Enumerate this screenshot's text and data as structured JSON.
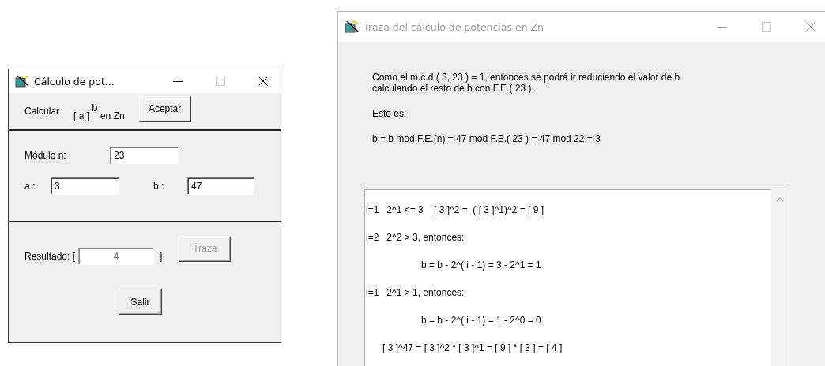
{
  "calc_window": {
    "title": "Cálculo de pot...",
    "active": true,
    "header": {
      "label": "Calcular",
      "expression": "[ a ] $^{b}$  en  Zn",
      "button": {
        "label": "Aceptar",
        "disabled": false
      }
    },
    "modulo": {
      "label": "Módulo  n:",
      "value": "23"
    },
    "a": {
      "label": "a :",
      "value": "3"
    },
    "b": {
      "label": "b :",
      "value": "47"
    },
    "result": {
      "label": "Resultado:  [",
      "value": "4",
      "close": "]",
      "button": {
        "label": "Traza",
        "disabled": true
      }
    },
    "exit_button": {
      "label": "Salir",
      "disabled": false
    }
  },
  "trace_window": {
    "title": "Traza del cálculo de potencias en Zn",
    "active": false,
    "paragraphs": [
      "Como el m.c.d ( 3, 23 ) = 1, entonces se podrá ir reduciendo el valor de b\ncalculando el resto de b con F.E.( 23 ).",
      "Esto es:",
      "b = b mod F.E.(n) = 47 mod F.E.( 23 ) = 47 mod 22 = 3"
    ],
    "trace_lines": [
      {
        "kind": "step",
        "text": "i=1   2^1 <= 3    [ 3 ]^2 =  ( [ 3 ]^1)^2 = [ 9 ]"
      },
      {
        "kind": "step",
        "text": "i=2   2^2 > 3, entonces:"
      },
      {
        "kind": "detail",
        "text": "b = b - 2^( i - 1) = 3 - 2^1 = 1"
      },
      {
        "kind": "step",
        "text": "i=1   2^1 > 1, entonces:"
      },
      {
        "kind": "detail",
        "text": "b = b - 2^( i - 1) = 1 - 2^0 = 0"
      },
      {
        "kind": "result",
        "text": "[ 3 ]^47 = [ 3 ]^2 * [ 3 ]^1 = [ 9 ] * [ 3 ] = [ 4 ]"
      }
    ]
  }
}
